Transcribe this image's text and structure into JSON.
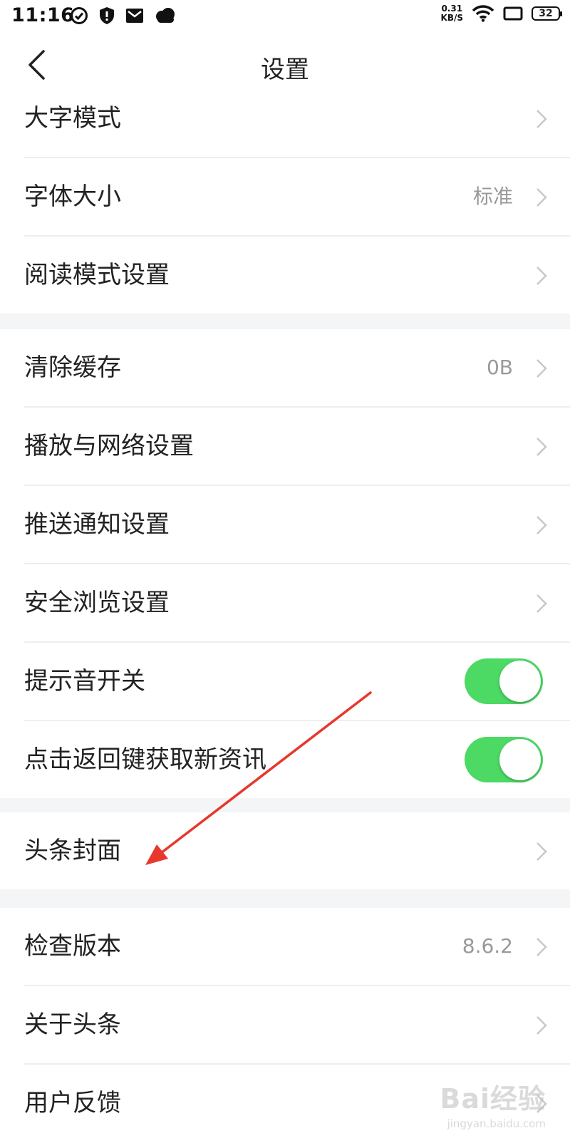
{
  "status_bar": {
    "time": "11:16",
    "speed_value": "0.31",
    "speed_unit": "KB/S",
    "battery_level": "32"
  },
  "navbar": {
    "title": "设置",
    "back_icon": "chevron-left-icon"
  },
  "groups": [
    {
      "items": [
        {
          "label": "大字模式",
          "value": "",
          "control": "chevron"
        },
        {
          "label": "字体大小",
          "value": "标准",
          "control": "chevron"
        },
        {
          "label": "阅读模式设置",
          "value": "",
          "control": "chevron"
        }
      ]
    },
    {
      "items": [
        {
          "label": "清除缓存",
          "value": "0B",
          "control": "chevron"
        },
        {
          "label": "播放与网络设置",
          "value": "",
          "control": "chevron"
        },
        {
          "label": "推送通知设置",
          "value": "",
          "control": "chevron"
        },
        {
          "label": "安全浏览设置",
          "value": "",
          "control": "chevron"
        },
        {
          "label": "提示音开关",
          "value": "",
          "control": "toggle",
          "on": true
        },
        {
          "label": "点击返回键获取新资讯",
          "value": "",
          "control": "toggle",
          "on": true
        }
      ]
    },
    {
      "items": [
        {
          "label": "头条封面",
          "value": "",
          "control": "chevron"
        }
      ]
    },
    {
      "items": [
        {
          "label": "检查版本",
          "value": "8.6.2",
          "control": "chevron"
        },
        {
          "label": "关于头条",
          "value": "",
          "control": "chevron"
        },
        {
          "label": "用户反馈",
          "value": "",
          "control": "chevron"
        }
      ]
    }
  ],
  "colors": {
    "toggle_on": "#4cd964",
    "annotation_arrow": "#e8372c",
    "value_text": "#999999",
    "page_background": "#f4f5f6"
  },
  "watermark": {
    "brand": "Bai经验",
    "domain": "jingyan.baidu.com"
  }
}
